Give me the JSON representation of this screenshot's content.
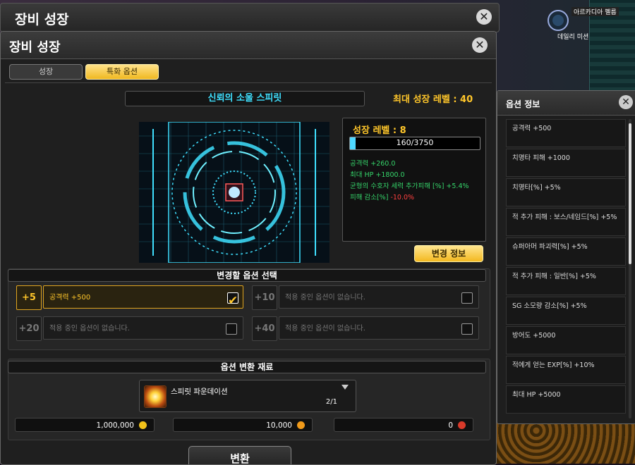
{
  "back_window": {
    "title": "장비 성장",
    "close": "✕"
  },
  "main_window": {
    "title": "장비 성장",
    "close": "✕"
  },
  "tabs": [
    {
      "label": "성장"
    },
    {
      "label": "특화 옵션"
    }
  ],
  "spirit": {
    "name": "신뢰의 소울 스피릿",
    "max_level": "최대 성장 레벨 : 40"
  },
  "growth": {
    "level_label": "성장 레벨 : 8",
    "xp_text": "160/3750",
    "xp_fraction": 0.0427,
    "stats": [
      {
        "text": "공격력 +260.0"
      },
      {
        "text": "최대 HP +1800.0"
      },
      {
        "text": "균형의 수호자 세력 추가피해 [%] +5.4%"
      },
      {
        "text": "피해 감소[%] ",
        "neg": "-10.0%"
      }
    ],
    "change_info_label": "변경 정보"
  },
  "option_select": {
    "title": "변경할 옵션 선택",
    "slots": [
      {
        "num": "+5",
        "text": "공격력 +500",
        "checked": true
      },
      {
        "num": "+10",
        "text": "적용 중인 옵션이 없습니다.",
        "checked": false
      },
      {
        "num": "+20",
        "text": "적용 중인 옵션이 없습니다.",
        "checked": false
      },
      {
        "num": "+40",
        "text": "적용 중인 옵션이 없습니다.",
        "checked": false
      }
    ]
  },
  "material": {
    "title": "옵션 변환 재료",
    "item_name": "스피릿 파운데이션",
    "count": "2/1",
    "costs": [
      {
        "value": "1,000,000",
        "color": "#f2c21a"
      },
      {
        "value": "10,000",
        "color": "#f09a1a"
      },
      {
        "value": "0",
        "color": "#d83a2a"
      }
    ],
    "convert_label": "변환"
  },
  "option_info": {
    "title": "옵션 정보",
    "close": "✕",
    "items": [
      "공격력 +500",
      "치명타 피해 +1000",
      "치명타[%] +5%",
      "적 추가 피해 : 보스/네임드[%] +5%",
      "슈퍼아머 파괴력[%] +5%",
      "적 추가 피해 : 일반[%] +5%",
      "SG 소모량 감소[%] +5%",
      "방어도 +5000",
      "적에게 얻는 EXP[%] +10%",
      "최대 HP +5000"
    ]
  },
  "hud": {
    "daily_mission": "데일리 미션",
    "arcadia": "아르카디아 펠름"
  },
  "colors": {
    "accent": "#ffc62a",
    "cyan": "#3fe0ff",
    "stat_green": "#35d46a",
    "negative": "#ff4040"
  }
}
